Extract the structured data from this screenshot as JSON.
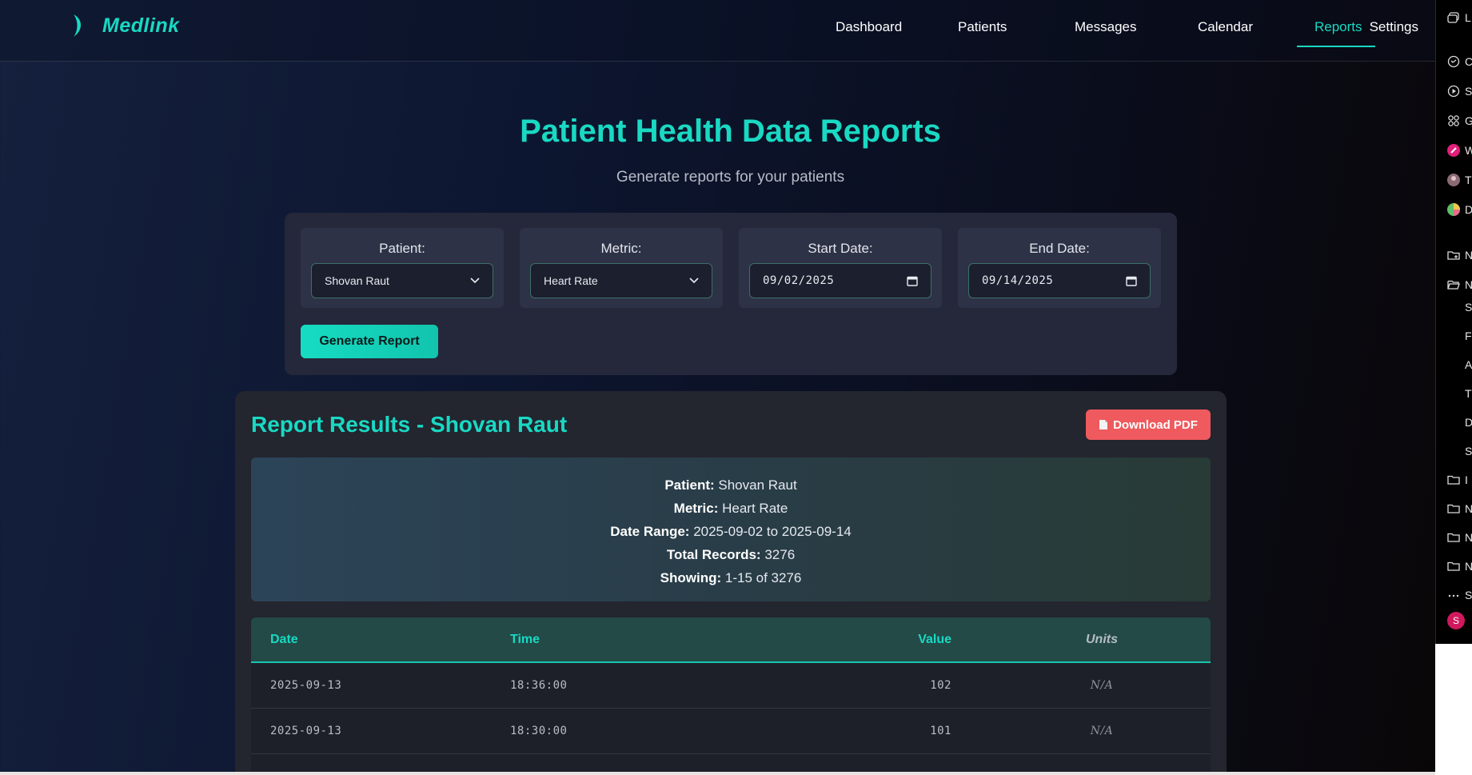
{
  "brand": {
    "name": "Medlink",
    "logo_icon": "crescent-logo-icon",
    "color": "#19d9c3"
  },
  "nav": {
    "items": [
      {
        "label": "Dashboard"
      },
      {
        "label": "Patients"
      },
      {
        "label": "Messages"
      },
      {
        "label": "Calendar"
      },
      {
        "label": "Reports",
        "active": true
      },
      {
        "label": "Settings"
      }
    ]
  },
  "header": {
    "title": "Patient Health Data Reports",
    "subtitle": "Generate reports for your patients"
  },
  "filters": {
    "patient": {
      "label": "Patient:",
      "value": "Shovan Raut"
    },
    "metric": {
      "label": "Metric:",
      "value": "Heart Rate"
    },
    "start_date": {
      "label": "Start Date:",
      "value": "09/02/2025"
    },
    "end_date": {
      "label": "End Date:",
      "value": "09/14/2025"
    },
    "generate_label": "Generate Report"
  },
  "results": {
    "title": "Report Results - Shovan Raut",
    "download_label": "Download PDF",
    "summary": [
      {
        "key": "Patient:",
        "value": "Shovan Raut"
      },
      {
        "key": "Metric:",
        "value": "Heart Rate"
      },
      {
        "key": "Date Range:",
        "value": "2025-09-02 to 2025-09-14"
      },
      {
        "key": "Total Records:",
        "value": "3276"
      },
      {
        "key": "Showing:",
        "value": "1-15 of 3276"
      }
    ],
    "table": {
      "headers": {
        "date": "Date",
        "time": "Time",
        "value": "Value",
        "units": "Units"
      },
      "rows": [
        {
          "date": "2025-09-13",
          "time": "18:36:00",
          "value": "102",
          "units": "N/A"
        },
        {
          "date": "2025-09-13",
          "time": "18:30:00",
          "value": "101",
          "units": "N/A"
        }
      ]
    }
  },
  "sidepanel": {
    "items": [
      {
        "icon": "tabs-icon",
        "char": "L"
      },
      {
        "icon": "history-icon",
        "char": "C"
      },
      {
        "icon": "play-icon",
        "char": "S"
      },
      {
        "icon": "grid-icon",
        "char": "G"
      },
      {
        "icon": "pen-icon",
        "char": "W"
      },
      {
        "icon": "avatar-icon",
        "char": "T"
      },
      {
        "icon": "color-wheel-icon",
        "char": "D"
      },
      {
        "icon": "folder-add-icon",
        "char": "N"
      },
      {
        "icon": "folder-open-icon",
        "char": "N"
      },
      {
        "icon": "folder-icon",
        "char": "I"
      },
      {
        "icon": "folder-icon",
        "char": "N"
      },
      {
        "icon": "folder-icon",
        "char": "N"
      },
      {
        "icon": "folder-icon",
        "char": "N"
      },
      {
        "icon": "more-icon",
        "char": "S"
      }
    ],
    "subitems": [
      "S",
      "F",
      "A",
      "T",
      "D",
      "S"
    ],
    "avatar": "S"
  }
}
